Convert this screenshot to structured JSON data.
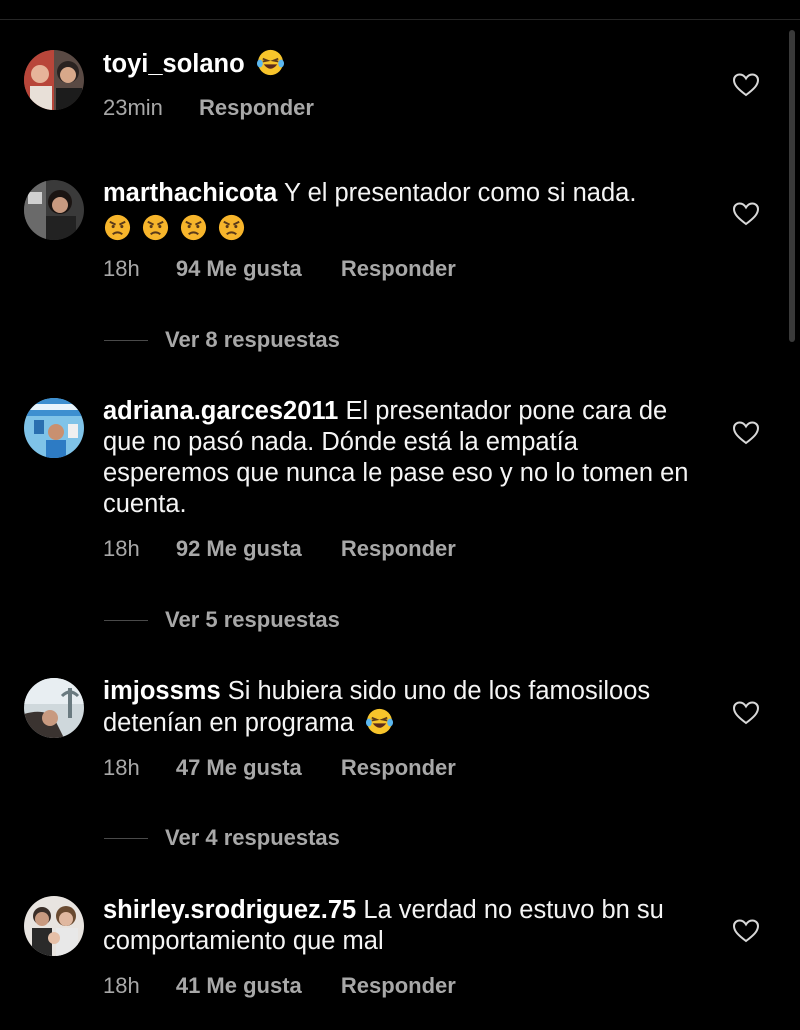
{
  "comments": [
    {
      "username": "toyi_solano",
      "text": "",
      "emojis": [
        "laughing-tears"
      ],
      "time": "23min",
      "likes": "",
      "reply_label": "Responder",
      "view_replies": ""
    },
    {
      "username": "marthachicota",
      "text": "Y el presentador como si nada.",
      "emojis": [
        "angry",
        "angry",
        "angry",
        "angry"
      ],
      "time": "18h",
      "likes": "94 Me gusta",
      "reply_label": "Responder",
      "view_replies": "Ver 8 respuestas"
    },
    {
      "username": "adriana.garces2011",
      "text": "El presentador pone cara de que no pasó nada. Dónde está la empatía esperemos que nunca le pase eso y no lo tomen en cuenta.",
      "emojis": [],
      "time": "18h",
      "likes": "92 Me gusta",
      "reply_label": "Responder",
      "view_replies": "Ver 5 respuestas"
    },
    {
      "username": "imjossms",
      "text": "Si hubiera sido uno de los famosiloos detenían en programa",
      "emojis": [
        "laughing-tears"
      ],
      "time": "18h",
      "likes": "47 Me gusta",
      "reply_label": "Responder",
      "view_replies": "Ver 4 respuestas"
    },
    {
      "username": "shirley.srodriguez.75",
      "text": "La verdad no estuvo bn su comportamiento que mal",
      "emojis": [],
      "time": "18h",
      "likes": "41 Me gusta",
      "reply_label": "Responder",
      "view_replies": ""
    }
  ],
  "colors": {
    "background": "#000000",
    "primary_text": "#f5f5f5",
    "secondary_text": "#a8a8a8",
    "emoji_face": "#f7c42b"
  }
}
